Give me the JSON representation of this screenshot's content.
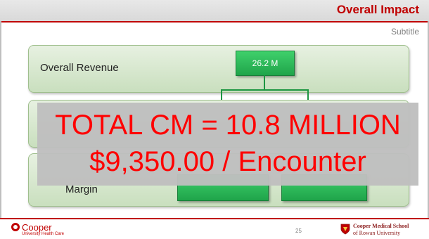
{
  "slide": {
    "title": "Overall Impact",
    "subtitle": "Subtitle",
    "rows": [
      {
        "label": "Overall Revenue",
        "node": "26.2 M"
      },
      {
        "label": "",
        "node": ""
      },
      {
        "label": "Margin",
        "nodes": [
          "",
          ""
        ]
      }
    ],
    "overlay": {
      "line1": "TOTAL CM  = 10.8 MILLION",
      "line2": "$9,350.00 / Encounter"
    },
    "page_number": "25"
  },
  "footer": {
    "left_logo": {
      "name": "Cooper",
      "sub": "University Health Care"
    },
    "right_logo": {
      "name": "Cooper Medical School",
      "sub": "of Rowan University"
    }
  },
  "colors": {
    "accent_red": "#c00000",
    "node_green": "#1fa44a",
    "bar_green": "#c9dfbe",
    "overlay_text": "#ff0000"
  }
}
